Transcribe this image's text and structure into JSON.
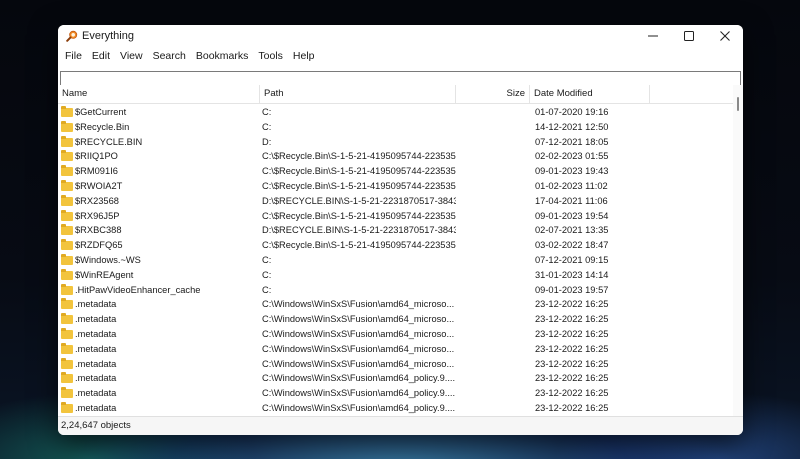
{
  "window": {
    "title": "Everything",
    "icon": "magnifier-icon",
    "accent": "#e8731a"
  },
  "menu": [
    {
      "label": "File"
    },
    {
      "label": "Edit"
    },
    {
      "label": "View"
    },
    {
      "label": "Search"
    },
    {
      "label": "Bookmarks"
    },
    {
      "label": "Tools"
    },
    {
      "label": "Help"
    }
  ],
  "search": {
    "value": "",
    "placeholder": ""
  },
  "columns": {
    "name": "Name",
    "path": "Path",
    "size": "Size",
    "date": "Date Modified"
  },
  "rows": [
    {
      "name": "$GetCurrent",
      "path": "C:",
      "size": "",
      "date": "01-07-2020 19:16"
    },
    {
      "name": "$Recycle.Bin",
      "path": "C:",
      "size": "",
      "date": "14-12-2021 12:50"
    },
    {
      "name": "$RECYCLE.BIN",
      "path": "D:",
      "size": "",
      "date": "07-12-2021 18:05"
    },
    {
      "name": "$RIIQ1PO",
      "path": "C:\\$Recycle.Bin\\S-1-5-21-4195095744-223535...",
      "size": "",
      "date": "02-02-2023 01:55"
    },
    {
      "name": "$RM091I6",
      "path": "C:\\$Recycle.Bin\\S-1-5-21-4195095744-223535...",
      "size": "",
      "date": "09-01-2023 19:43"
    },
    {
      "name": "$RWOIA2T",
      "path": "C:\\$Recycle.Bin\\S-1-5-21-4195095744-223535...",
      "size": "",
      "date": "01-02-2023 11:02"
    },
    {
      "name": "$RX23568",
      "path": "D:\\$RECYCLE.BIN\\S-1-5-21-2231870517-3843...",
      "size": "",
      "date": "17-04-2021 11:06"
    },
    {
      "name": "$RX96J5P",
      "path": "C:\\$Recycle.Bin\\S-1-5-21-4195095744-223535...",
      "size": "",
      "date": "09-01-2023 19:54"
    },
    {
      "name": "$RXBC388",
      "path": "D:\\$RECYCLE.BIN\\S-1-5-21-2231870517-3843...",
      "size": "",
      "date": "02-07-2021 13:35"
    },
    {
      "name": "$RZDFQ65",
      "path": "C:\\$Recycle.Bin\\S-1-5-21-4195095744-223535...",
      "size": "",
      "date": "03-02-2022 18:47"
    },
    {
      "name": "$Windows.~WS",
      "path": "C:",
      "size": "",
      "date": "07-12-2021 09:15"
    },
    {
      "name": "$WinREAgent",
      "path": "C:",
      "size": "",
      "date": "31-01-2023 14:14"
    },
    {
      "name": ".HitPawVideoEnhancer_cache",
      "path": "C:",
      "size": "",
      "date": "09-01-2023 19:57"
    },
    {
      "name": ".metadata",
      "path": "C:\\Windows\\WinSxS\\Fusion\\amd64_microso...",
      "size": "",
      "date": "23-12-2022 16:25"
    },
    {
      "name": ".metadata",
      "path": "C:\\Windows\\WinSxS\\Fusion\\amd64_microso...",
      "size": "",
      "date": "23-12-2022 16:25"
    },
    {
      "name": ".metadata",
      "path": "C:\\Windows\\WinSxS\\Fusion\\amd64_microso...",
      "size": "",
      "date": "23-12-2022 16:25"
    },
    {
      "name": ".metadata",
      "path": "C:\\Windows\\WinSxS\\Fusion\\amd64_microso...",
      "size": "",
      "date": "23-12-2022 16:25"
    },
    {
      "name": ".metadata",
      "path": "C:\\Windows\\WinSxS\\Fusion\\amd64_microso...",
      "size": "",
      "date": "23-12-2022 16:25"
    },
    {
      "name": ".metadata",
      "path": "C:\\Windows\\WinSxS\\Fusion\\amd64_policy.9....",
      "size": "",
      "date": "23-12-2022 16:25"
    },
    {
      "name": ".metadata",
      "path": "C:\\Windows\\WinSxS\\Fusion\\amd64_policy.9....",
      "size": "",
      "date": "23-12-2022 16:25"
    },
    {
      "name": ".metadata",
      "path": "C:\\Windows\\WinSxS\\Fusion\\amd64_policy.9....",
      "size": "",
      "date": "23-12-2022 16:25"
    }
  ],
  "row_icon": "folder-icon",
  "status": {
    "text": "2,24,647 objects"
  }
}
